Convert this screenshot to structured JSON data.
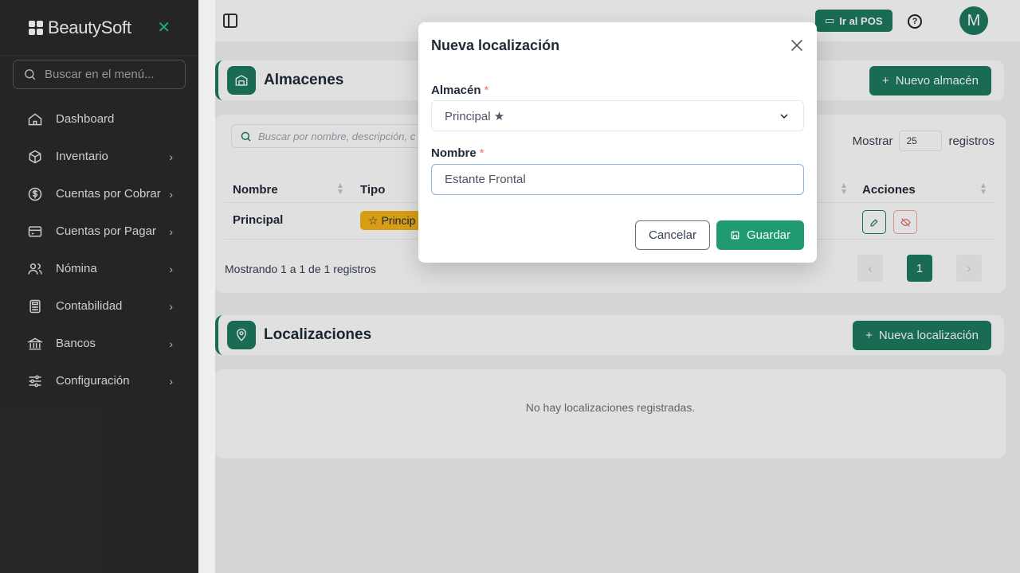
{
  "sidebar": {
    "brand": "BeautySoft",
    "search_placeholder": "Buscar en el menú...",
    "items": [
      {
        "label": "Dashboard"
      },
      {
        "label": "Inventario"
      },
      {
        "label": "Cuentas por Cobrar"
      },
      {
        "label": "Cuentas por Pagar"
      },
      {
        "label": "Nómina"
      },
      {
        "label": "Contabilidad"
      },
      {
        "label": "Bancos"
      },
      {
        "label": "Configuración"
      }
    ]
  },
  "topbar": {
    "pos_label": "Ir al POS",
    "avatar_initial": "M"
  },
  "almacenes": {
    "title": "Almacenes",
    "new_button": "Nuevo almacén",
    "search_placeholder": "Buscar por nombre, descripción, c",
    "show_label": "Mostrar",
    "show_value": "25",
    "records_label": "registros",
    "columns": {
      "nombre": "Nombre",
      "tipo": "Tipo",
      "acciones": "Acciones"
    },
    "rows": [
      {
        "nombre": "Principal",
        "tipo": "Princip"
      }
    ],
    "pagination_info": "Mostrando 1 a 1 de 1 registros",
    "current_page": "1",
    "prev": "‹",
    "next": "›"
  },
  "localizaciones": {
    "title": "Localizaciones",
    "new_button": "Nueva localización",
    "empty_text": "No hay localizaciones registradas."
  },
  "modal": {
    "title": "Nueva localización",
    "almacen_label": "Almacén",
    "almacen_value": "Principal ★",
    "nombre_label": "Nombre",
    "nombre_value": "Estante Frontal",
    "required_mark": "*",
    "cancel_label": "Cancelar",
    "save_label": "Guardar"
  },
  "colors": {
    "brand_green": "#1d7a5f",
    "save_green": "#1f9a72",
    "badge_yellow": "#f5b419",
    "sidebar_bg": "#2b2b2a"
  }
}
